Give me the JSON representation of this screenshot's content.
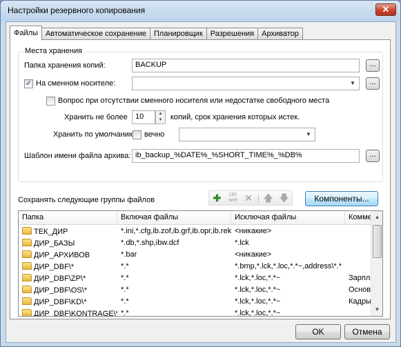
{
  "window": {
    "title": "Настройки резервного копирования",
    "close_label": "✕"
  },
  "tabs": [
    "Файлы",
    "Автоматическое сохранение",
    "Планировщик",
    "Разрешения",
    "Архиватор"
  ],
  "storage": {
    "group_label": "Места хранения",
    "backup_folder_label": "Папка хранения копий:",
    "backup_folder_value": "BACKUP",
    "removable_label": "На сменном носителе:",
    "removable_checked": true,
    "removable_value": "",
    "ask_label": "Вопрос при отсутствии сменного носителя или недостатке свободного места",
    "ask_checked": false,
    "keep_label": "Хранить не более",
    "keep_value": "10",
    "keep_suffix": "копий, срок хранения которых истек.",
    "default_keep_label": "Хранить по умолчанию",
    "forever_label": "вечно",
    "forever_checked": false,
    "template_label": "Шаблон имени файла архива:",
    "template_value": "ib_backup_%DATE%_%SHORT_TIME%_%DB%",
    "browse_label": "..."
  },
  "groups": {
    "label": "Сохранять следующие группы файлов",
    "components_button": "Компоненты...",
    "toolbar_icons": [
      "add-icon",
      "rotate-180-icon",
      "delete-icon",
      "move-up-icon",
      "move-down-icon"
    ]
  },
  "table": {
    "headers": [
      "Папка",
      "Включая файлы",
      "Исключая файлы",
      "Комме"
    ],
    "rows": [
      {
        "folder": "ТЕК_ДИР",
        "include": "*.ini,*.cfg,ib.zof,ib.grf,ib.opr,ib.rek",
        "exclude": "<никакие>",
        "comment": ""
      },
      {
        "folder": "ДИР_БАЗЫ",
        "include": "*.db,*.shp,ibw.dcf",
        "exclude": "*.lck",
        "comment": ""
      },
      {
        "folder": "ДИР_АРХИВОВ",
        "include": "*.bar",
        "exclude": "<никакие>",
        "comment": ""
      },
      {
        "folder": "ДИР_DBF\\*",
        "include": "*.*",
        "exclude": "*.bmp,*.lck,*.loc,*.*~,address\\*.*",
        "comment": ""
      },
      {
        "folder": "ДИР_DBF\\ZP\\*",
        "include": "*.*",
        "exclude": "*.lck,*.loc,*.*~",
        "comment": "Зарпла"
      },
      {
        "folder": "ДИР_DBF\\OS\\*",
        "include": "*.*",
        "exclude": "*.lck,*.loc,*.*~",
        "comment": "Основн"
      },
      {
        "folder": "ДИР_DBF\\KD\\*",
        "include": "*.*",
        "exclude": "*.lck,*.loc,*.*~",
        "comment": "Кадры"
      },
      {
        "folder": "ДИР_DBF\\KONTRAGE\\*",
        "include": "*.*",
        "exclude": "*.lck,*.loc,*.*~",
        "comment": ""
      }
    ]
  },
  "footer": {
    "ok": "OK",
    "cancel": "Отмена"
  }
}
